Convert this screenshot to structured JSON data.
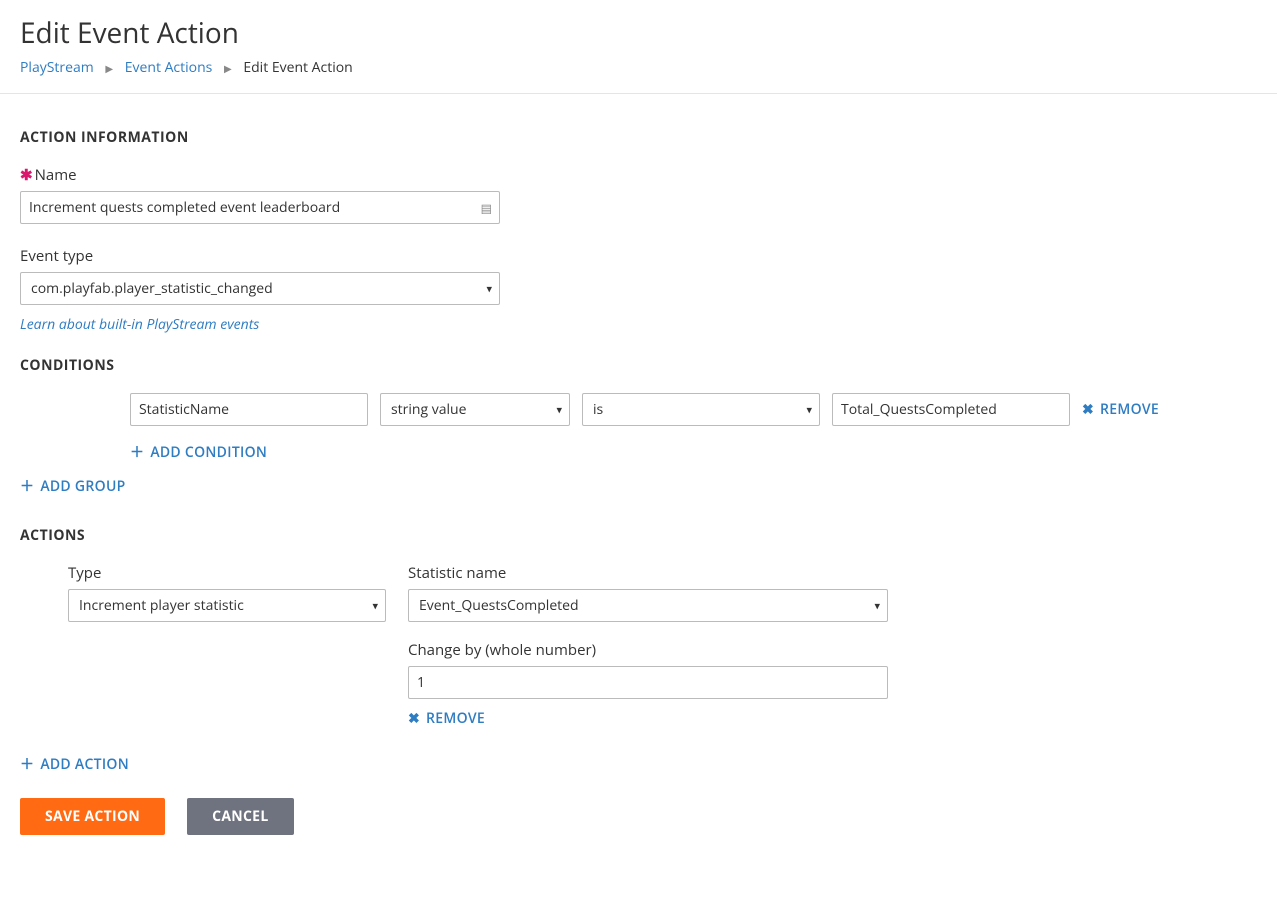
{
  "header": {
    "title": "Edit Event Action",
    "breadcrumb": {
      "playstream": "PlayStream",
      "event_actions": "Event Actions",
      "current": "Edit Event Action"
    }
  },
  "action_info": {
    "heading": "ACTION INFORMATION",
    "name_label": "Name",
    "name_value": "Increment quests completed event leaderboard",
    "event_type_label": "Event type",
    "event_type_value": "com.playfab.player_statistic_changed",
    "learn_link": "Learn about built-in PlayStream events"
  },
  "conditions": {
    "heading": "CONDITIONS",
    "row": {
      "field_value": "StatisticName",
      "type_value": "string value",
      "operator_value": "is",
      "compare_value": "Total_QuestsCompleted"
    },
    "remove_label": "REMOVE",
    "add_condition_label": "ADD CONDITION",
    "add_group_label": "ADD GROUP"
  },
  "actions_section": {
    "heading": "ACTIONS",
    "row": {
      "type_label": "Type",
      "type_value": "Increment player statistic",
      "stat_label": "Statistic name",
      "stat_value": "Event_QuestsCompleted",
      "change_label": "Change by (whole number)",
      "change_value": "1"
    },
    "remove_label": "REMOVE",
    "add_action_label": "ADD ACTION"
  },
  "buttons": {
    "save": "SAVE ACTION",
    "cancel": "CANCEL"
  }
}
